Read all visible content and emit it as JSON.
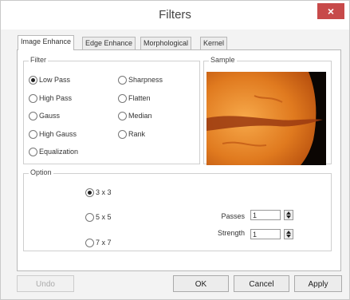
{
  "window": {
    "title": "Filters",
    "close_symbol": "×"
  },
  "tabs": [
    {
      "label": "Image Enhance",
      "active": true
    },
    {
      "label": "Edge Enhance",
      "active": false
    },
    {
      "label": "Morphological",
      "active": false
    },
    {
      "label": "Kernel",
      "active": false
    }
  ],
  "filter_group": {
    "label": "Filter",
    "options": [
      {
        "label": "Low Pass",
        "checked": true
      },
      {
        "label": "High Pass",
        "checked": false
      },
      {
        "label": "Gauss",
        "checked": false
      },
      {
        "label": "High Gauss",
        "checked": false
      },
      {
        "label": "Equalization",
        "checked": false
      },
      {
        "label": "Sharpness",
        "checked": false
      },
      {
        "label": "Flatten",
        "checked": false
      },
      {
        "label": "Median",
        "checked": false
      },
      {
        "label": "Rank",
        "checked": false
      }
    ]
  },
  "sample_group": {
    "label": "Sample"
  },
  "option_group": {
    "label": "Option",
    "sizes": [
      {
        "label": "3 x 3",
        "checked": true
      },
      {
        "label": "5 x 5",
        "checked": false
      },
      {
        "label": "7 x 7",
        "checked": false
      }
    ],
    "passes": {
      "label": "Passes",
      "value": "1"
    },
    "strength": {
      "label": "Strength",
      "value": "1"
    }
  },
  "buttons": {
    "undo": "Undo",
    "ok": "OK",
    "cancel": "Cancel",
    "apply": "Apply"
  },
  "colors": {
    "close": "#c74a4a",
    "sun": "#e07a1f",
    "background": "#f3f3f3"
  }
}
